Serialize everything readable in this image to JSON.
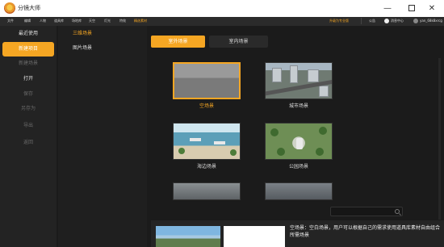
{
  "window": {
    "title": "分镜大师",
    "controls": {
      "minimize": "—",
      "maximize": "",
      "close": "✕"
    }
  },
  "menubar": {
    "items": [
      "文件",
      "编辑",
      "人物",
      "道具库",
      "场地库",
      "天空",
      "灯光",
      "特效"
    ],
    "highlight_item": "精选素材",
    "vip_label": "升级为专业版",
    "notice_label": "公告",
    "message_label": "消息中心",
    "user_label": "yan_68k8xrcg"
  },
  "sidebar": {
    "items": [
      {
        "label": "最近使用",
        "state": "normal"
      },
      {
        "label": "新建项目",
        "state": "active"
      },
      {
        "label": "新建场景",
        "state": "muted"
      },
      {
        "label": "打开",
        "state": "normal"
      },
      {
        "label": "保存",
        "state": "muted"
      },
      {
        "label": "另存为",
        "state": "muted"
      },
      {
        "label": "导出",
        "state": "muted"
      },
      {
        "label": "返回",
        "state": "muted"
      }
    ]
  },
  "subpanel": {
    "items": [
      {
        "label": "三维场景",
        "state": "active"
      },
      {
        "label": "图片场景",
        "state": "normal"
      }
    ]
  },
  "tabs": [
    {
      "label": "室外场景",
      "state": "active"
    },
    {
      "label": "室内场景",
      "state": "normal"
    }
  ],
  "scenes": [
    {
      "label": "空场景",
      "icon": "empty-ground",
      "selected": true
    },
    {
      "label": "城市场景",
      "icon": "city-aerial",
      "selected": false
    },
    {
      "label": "海边场景",
      "icon": "seaside",
      "selected": false
    },
    {
      "label": "公园场景",
      "icon": "park-fountain",
      "selected": false
    },
    {
      "label": "",
      "icon": "rain-scene",
      "selected": false
    },
    {
      "label": "",
      "icon": "rain-scene",
      "selected": false
    }
  ],
  "search": {
    "placeholder": ""
  },
  "preview": {
    "description": "空场景：空白场景，用户可以根据自己的需求使用道具库素材自由组合所需场景"
  },
  "colors": {
    "accent": "#f5a623",
    "background": "#1b1b1b",
    "sidebar": "#232323"
  }
}
